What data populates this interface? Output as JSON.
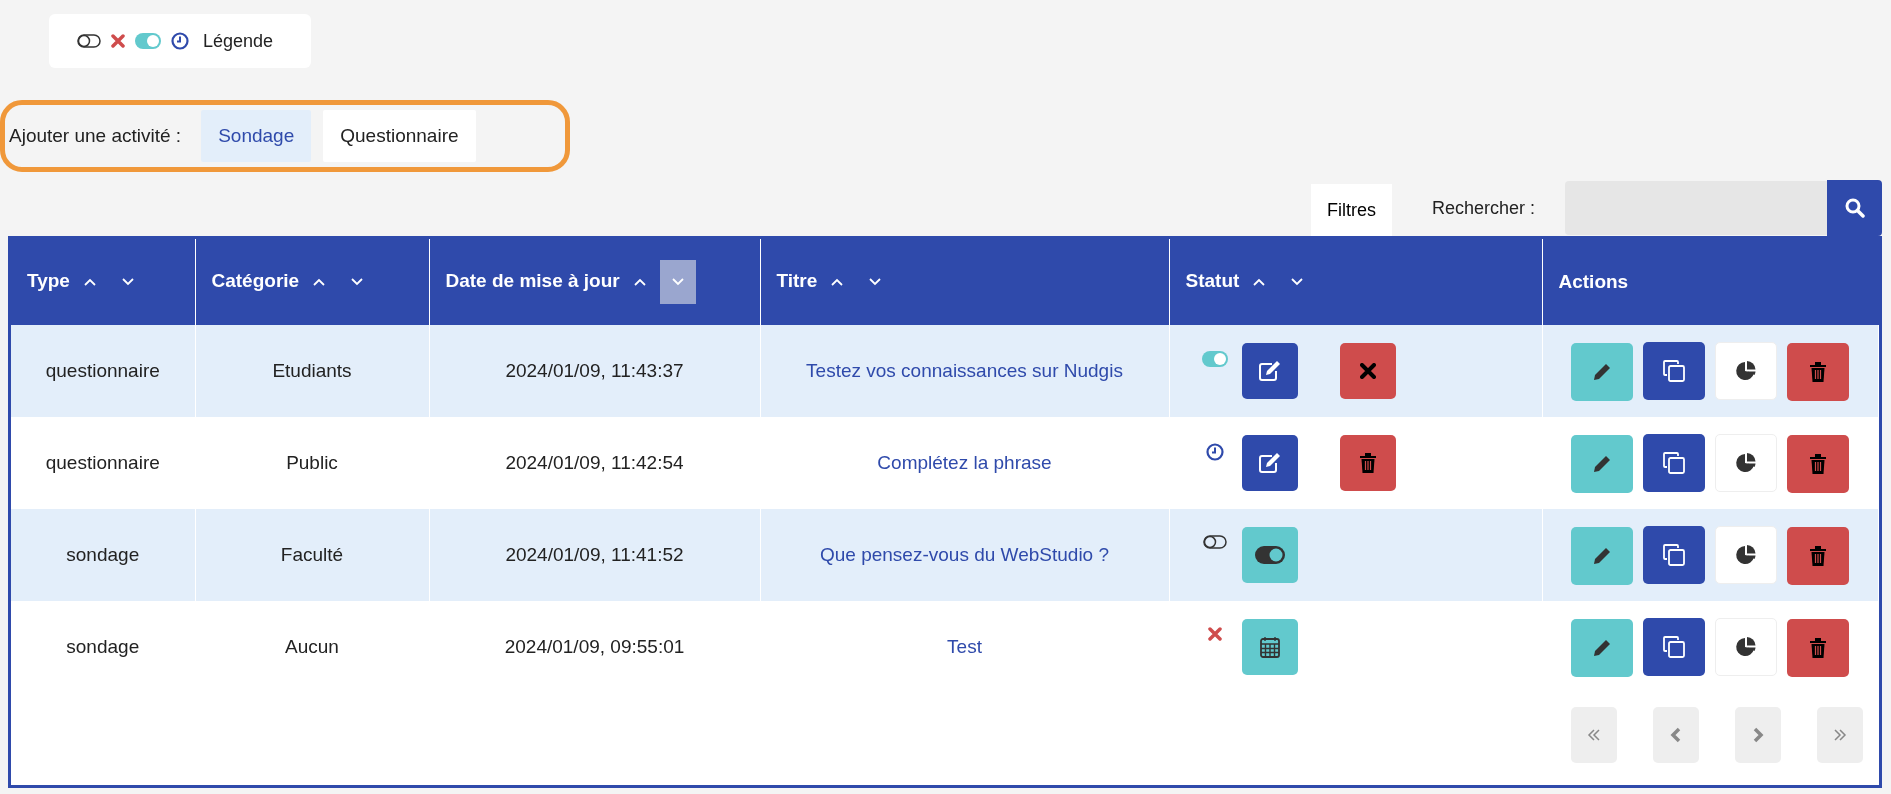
{
  "legend": {
    "label": "Légende"
  },
  "add_activity": {
    "label": "Ajouter une activité :",
    "options": [
      {
        "label": "Sondage",
        "selected": true
      },
      {
        "label": "Questionnaire",
        "selected": false
      }
    ]
  },
  "toolbar": {
    "filters": "Filtres",
    "search_label": "Rechercher :"
  },
  "table": {
    "columns": [
      {
        "label": "Type",
        "sortable": true,
        "sort_asc": false,
        "sort_desc": false
      },
      {
        "label": "Catégorie",
        "sortable": true,
        "sort_asc": false,
        "sort_desc": false
      },
      {
        "label": "Date de mise à jour",
        "sortable": true,
        "sort_asc": false,
        "sort_desc": true
      },
      {
        "label": "Titre",
        "sortable": true,
        "sort_asc": false,
        "sort_desc": false
      },
      {
        "label": "Statut",
        "sortable": true,
        "sort_asc": false,
        "sort_desc": false
      },
      {
        "label": "Actions",
        "sortable": false
      }
    ],
    "rows": [
      {
        "type": "questionnaire",
        "category": "Etudiants",
        "date": "2024/01/09, 11:43:37",
        "title": "Testez vos connaissances sur Nudgis",
        "status": {
          "kind": "active"
        },
        "status_actions": [
          {
            "kind": "edit"
          },
          {
            "kind": "close"
          }
        ]
      },
      {
        "type": "questionnaire",
        "category": "Public",
        "date": "2024/01/09, 11:42:54",
        "title": "Complétez la phrase",
        "status": {
          "kind": "scheduled"
        },
        "status_actions": [
          {
            "kind": "edit"
          },
          {
            "kind": "delete"
          }
        ]
      },
      {
        "type": "sondage",
        "category": "Faculté",
        "date": "2024/01/09, 11:41:52",
        "title": "Que pensez-vous du WebStudio ?",
        "status": {
          "kind": "inactive"
        },
        "status_actions": [
          {
            "kind": "toggle"
          }
        ]
      },
      {
        "type": "sondage",
        "category": "Aucun",
        "date": "2024/01/09, 09:55:01",
        "title": "Test",
        "status": {
          "kind": "closed"
        },
        "status_actions": [
          {
            "kind": "schedule"
          }
        ]
      }
    ]
  }
}
